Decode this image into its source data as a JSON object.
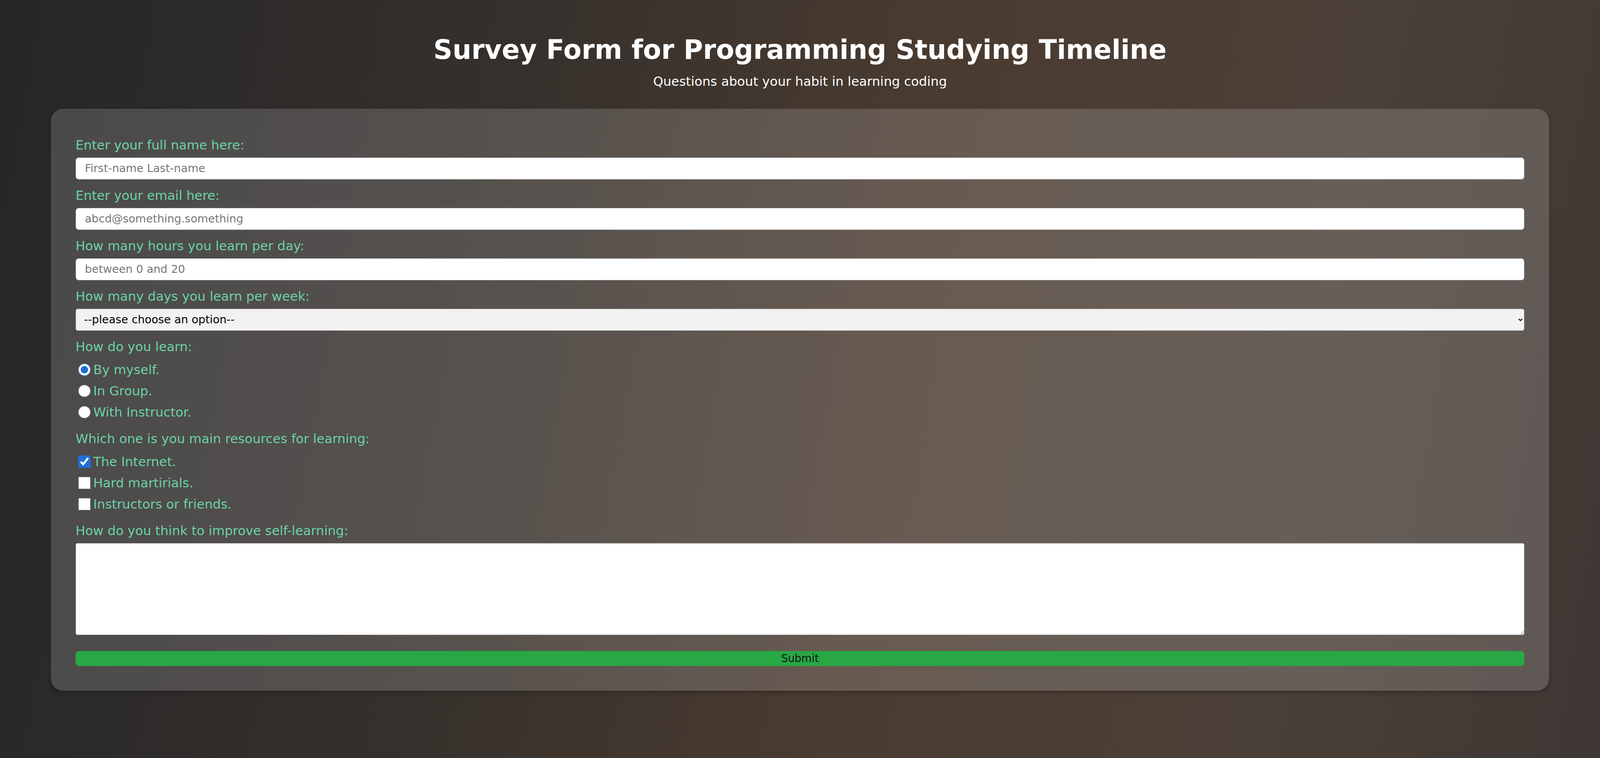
{
  "page": {
    "title": "Survey Form for Programming Studying Timeline",
    "subtitle": "Questions about your habit in learning coding"
  },
  "form": {
    "name": {
      "label": "Enter your full name here:",
      "placeholder": "First-name Last-name"
    },
    "email": {
      "label": "Enter your email here:",
      "placeholder": "abcd@something.something"
    },
    "hours": {
      "label": "How many hours you learn per day:",
      "placeholder": "between 0 and 20"
    },
    "days": {
      "label": "How many days you learn per week:",
      "value": "--please choose an option--"
    },
    "method": {
      "label": "How do you learn:",
      "options": [
        {
          "label": "By myself.",
          "selected": true
        },
        {
          "label": "In Group.",
          "selected": false
        },
        {
          "label": "With Instructor.",
          "selected": false
        }
      ]
    },
    "resources": {
      "label": "Which one is you main resources for learning:",
      "options": [
        {
          "label": "The Internet.",
          "checked": true
        },
        {
          "label": "Hard martirials.",
          "checked": false
        },
        {
          "label": "Instructors or friends.",
          "checked": false
        }
      ]
    },
    "improve": {
      "label": "How do you think to improve self-learning:",
      "value": ""
    },
    "submit": "Submit"
  }
}
